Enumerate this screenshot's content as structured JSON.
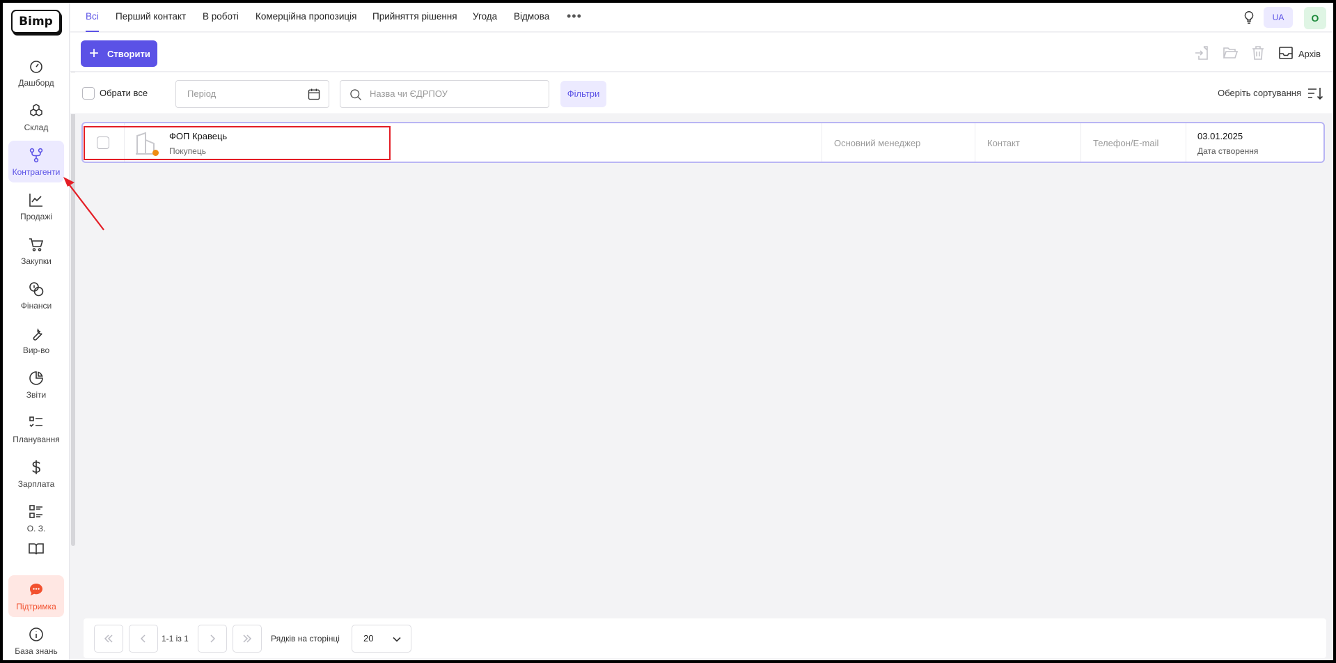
{
  "brand": {
    "logo_text": "Bimp"
  },
  "sidebar": {
    "items": [
      {
        "label": "Дашборд",
        "icon": "dashboard-icon"
      },
      {
        "label": "Склад",
        "icon": "warehouse-icon"
      },
      {
        "label": "Контрагенти",
        "icon": "counterparties-icon",
        "active": true
      },
      {
        "label": "Продажі",
        "icon": "sales-chart-icon"
      },
      {
        "label": "Закупки",
        "icon": "cart-icon"
      },
      {
        "label": "Фінанси",
        "icon": "coins-icon"
      },
      {
        "label": "Вир-во",
        "icon": "wrench-icon"
      },
      {
        "label": "Звіти",
        "icon": "pie-chart-icon"
      },
      {
        "label": "Планування",
        "icon": "checklist-icon"
      },
      {
        "label": "Зарплата",
        "icon": "dollar-icon"
      },
      {
        "label": "О. З.",
        "icon": "fixed-assets-icon"
      },
      {
        "label": "",
        "icon": "book-icon"
      }
    ],
    "support": {
      "label": "Підтримка",
      "icon": "chat-icon"
    },
    "knowledge": {
      "label": "База знань",
      "icon": "info-icon"
    }
  },
  "tabs": [
    {
      "label": "Всі",
      "active": true
    },
    {
      "label": "Перший контакт"
    },
    {
      "label": "В роботі"
    },
    {
      "label": "Комерційна пропозиція"
    },
    {
      "label": "Прийняття рішення"
    },
    {
      "label": "Угода"
    },
    {
      "label": "Відмова"
    }
  ],
  "header": {
    "more": "•••",
    "language": "UA",
    "user_initial": "O"
  },
  "toolbar": {
    "create_label": "Створити",
    "create_icon": "plus-icon",
    "archive_label": "Архів"
  },
  "filters": {
    "select_all_label": "Обрати все",
    "period_placeholder": "Період",
    "search_placeholder": "Назва чи ЄДРПОУ",
    "filters_label": "Фільтри",
    "sort_label": "Оберіть сортування"
  },
  "rows": [
    {
      "name": "ФОП Кравець",
      "role": "Покупець",
      "manager": "Основний менеджер",
      "contact": "Контакт",
      "phone_email": "Телефон/E-mail",
      "date": "03.01.2025",
      "date_label": "Дата створення",
      "status_color": "#ef8c12"
    }
  ],
  "pagination": {
    "range": "1-1 із 1",
    "rows_label": "Рядків на сторінці",
    "rows_per_page": "20"
  },
  "colors": {
    "accent": "#5b52e6",
    "accent_light": "#eceaff",
    "support": "#f2512f",
    "highlight": "#e41d25"
  }
}
